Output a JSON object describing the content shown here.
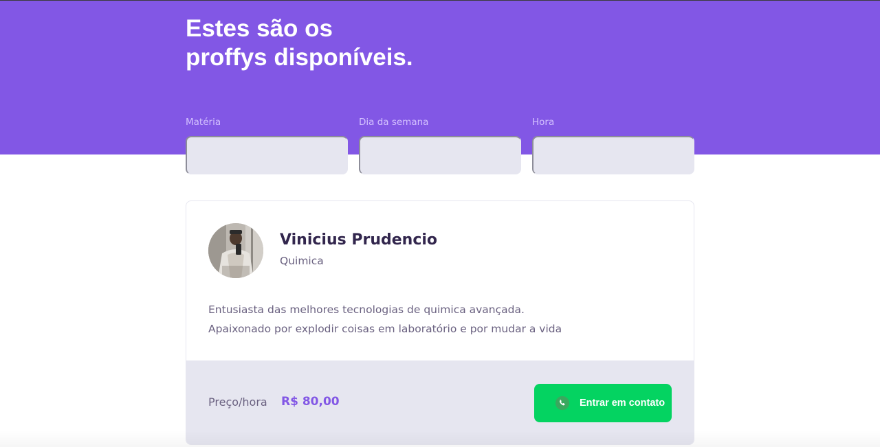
{
  "header": {
    "title_line1": "Estes são os",
    "title_line2": "proffys disponíveis."
  },
  "filters": [
    {
      "label": "Matéria",
      "value": "",
      "placeholder": ""
    },
    {
      "label": "Dia da semana",
      "value": "",
      "placeholder": ""
    },
    {
      "label": "Hora",
      "value": "",
      "placeholder": ""
    }
  ],
  "teacher": {
    "name": "Vinicius Prudencio",
    "subject": "Quimica",
    "bio_line1": "Entusiasta das melhores tecnologias de quimica avançada.",
    "bio_line2": "Apaixonado por explodir coisas em laboratório e por mudar a vida",
    "price_label": "Preço/hora",
    "price_value": "R$ 80,00",
    "contact_label": "Entrar em contato",
    "contact_icon": "whatsapp-icon"
  },
  "colors": {
    "primary": "#8257e5",
    "secondary": "#04d361",
    "title_text": "#32264d",
    "body_text": "#6a6180",
    "input_bg": "#e6e6f0"
  }
}
